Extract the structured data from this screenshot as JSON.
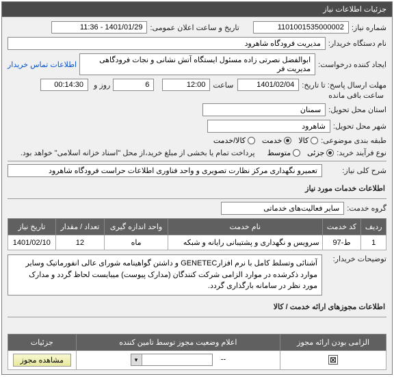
{
  "panel_title": "جزئیات اطلاعات نیاز",
  "fields": {
    "request_no_label": "شماره نیاز:",
    "request_no": "1101001535000002",
    "announce_label": "تاریخ و ساعت اعلان عمومی:",
    "announce_value": "1401/01/29 - 11:36",
    "buyer_label": "نام دستگاه خریدار:",
    "buyer_value": "مدیریت فرودگاه شاهرود",
    "creator_label": "ایجاد کننده درخواست:",
    "creator_value": "ابوالفضل نصرتی زاده مسئول ایستگاه آتش نشانی و نجات فرودگاهی مدیریت فر",
    "contact_link": "اطلاعات تماس خریدار",
    "deadline_label": "مهلت ارسال پاسخ: تا تاریخ:",
    "deadline_date": "1401/02/04",
    "time_label": "ساعت",
    "deadline_time": "12:00",
    "days_value": "6",
    "days_label": "روز و",
    "remaining_time": "00:14:30",
    "remaining_label": "ساعت باقی مانده",
    "province_label": "استان محل تحویل:",
    "province_value": "سمنان",
    "city_label": "شهر محل تحویل:",
    "city_value": "شاهرود",
    "subject_type_label": "طبقه بندی موضوعی:",
    "subject_options": {
      "goods": "کالا",
      "service": "خدمت",
      "both": "کالا/خدمت"
    },
    "process_label": "نوع فرآیند خرید:",
    "process_options": {
      "partial": "جزئی",
      "medium": "متوسط"
    },
    "payment_note": "پرداخت تمام یا بخشی از مبلغ خرید،از محل \"اسناد خزانه اسلامی\" خواهد بود.",
    "main_title_label": "شرح کلی نیاز:",
    "main_title_value": "تعمیرو نگهداری مرکز نظارت تصویری و واحد فناوری اطلاعات حراست فرودگاه شاهرود",
    "services_header": "اطلاعات خدمات مورد نیاز",
    "service_group_label": "گروه خدمت:",
    "service_group_value": "سایر فعالیت‌های خدماتی",
    "buyer_notes_label": "توضیحات خریدار:",
    "buyer_notes_value": "آشنائی وتسلط کامل با نرم افزارGENETEC و داشتن گواهینامه شورای عالی انفورماتیک وسایر موارد ذکرشده در موارد الزامی شرکت کنندگان (مدارک پیوست) میبایست لحاظ گردد و مدارک مورد نظر در سامانه بارگذاری گردد.",
    "permits_header": "اطلاعات مجوزهای ارائه خدمت / کالا"
  },
  "service_table": {
    "headers": [
      "ردیف",
      "کد خدمت",
      "نام خدمت",
      "واحد اندازه گیری",
      "تعداد / مقدار",
      "تاریخ نیاز"
    ],
    "rows": [
      {
        "idx": "1",
        "code": "ط-97",
        "name": "سرویس و نگهداری و پشتیبانی رایانه و شبکه",
        "unit": "ماه",
        "qty": "12",
        "date": "1401/02/10"
      }
    ]
  },
  "permit_table": {
    "headers": [
      "الزامی بودن ارائه مجوز",
      "اعلام وضعیت مجوز توسط تامین کننده",
      "جزئیات"
    ],
    "checked_mark": "⊠",
    "dash": "--",
    "view_btn": "مشاهده مجوز"
  }
}
